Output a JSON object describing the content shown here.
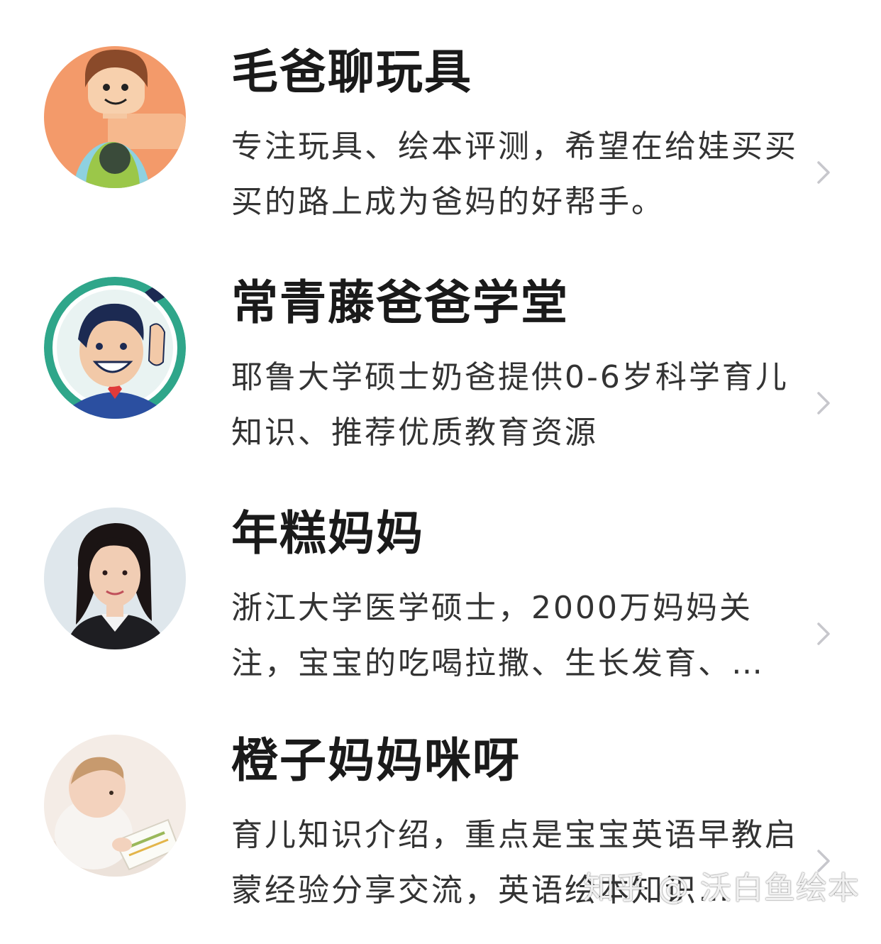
{
  "accounts": [
    {
      "name": "毛爸聊玩具",
      "description": "专注玩具、绘本评测，希望在给娃买买买的路上成为爸妈的好帮手。",
      "avatar": "toy-figure-avatar"
    },
    {
      "name": "常青藤爸爸学堂",
      "description": "耶鲁大学硕士奶爸提供0-6岁科学育儿知识、推荐优质教育资源",
      "avatar": "cartoon-dad-avatar"
    },
    {
      "name": "年糕妈妈",
      "description": "浙江大学医学硕士，2000万妈妈关注，宝宝的吃喝拉撒、生长发育、…",
      "avatar": "woman-portrait-avatar"
    },
    {
      "name": "橙子妈妈咪呀",
      "description": "育儿知识介绍，重点是宝宝英语早教启蒙经验分享交流，英语绘本知识…",
      "avatar": "baby-reading-avatar"
    }
  ],
  "watermark": "知乎 @ 沃白鱼绘本",
  "icons": {
    "chevron": "chevron-right-icon"
  },
  "colors": {
    "background": "#ffffff",
    "title": "#1a1a1a",
    "description": "#333333",
    "chevron": "#c7c7cc"
  }
}
